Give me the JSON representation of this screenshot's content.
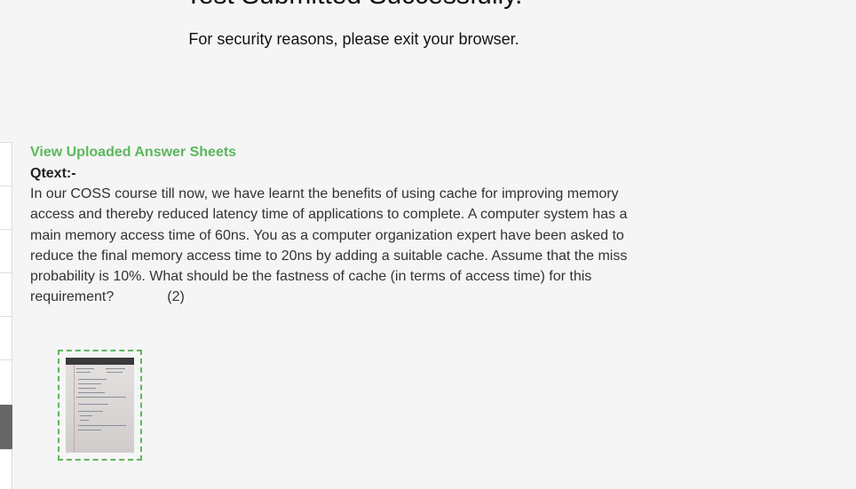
{
  "header": {
    "title": "Test Submitted Successfully.",
    "subtitle": "For security reasons, please exit your browser."
  },
  "answer_section": {
    "view_link": "View Uploaded Answer Sheets",
    "qtext_label": "Qtext:-",
    "question_text": "In our COSS course till now, we have learnt the benefits of using cache for improving memory access and thereby reduced latency time of applications to complete. A computer system has a main memory access time of 60ns. You as a computer organization expert have been asked to reduce the final memory access time to 20ns by adding a suitable cache. Assume that the miss probability is 10%. What should be the fastness of cache (in terms of access time) for this requirement?",
    "marks": "(2)"
  },
  "thumbnail": {
    "icon": "uploaded-answer-sheet-thumbnail",
    "frame_color": "#5cb85c"
  },
  "colors": {
    "accent": "#5cb85c",
    "background": "#f5f5f5",
    "rail_active": "#666666"
  }
}
